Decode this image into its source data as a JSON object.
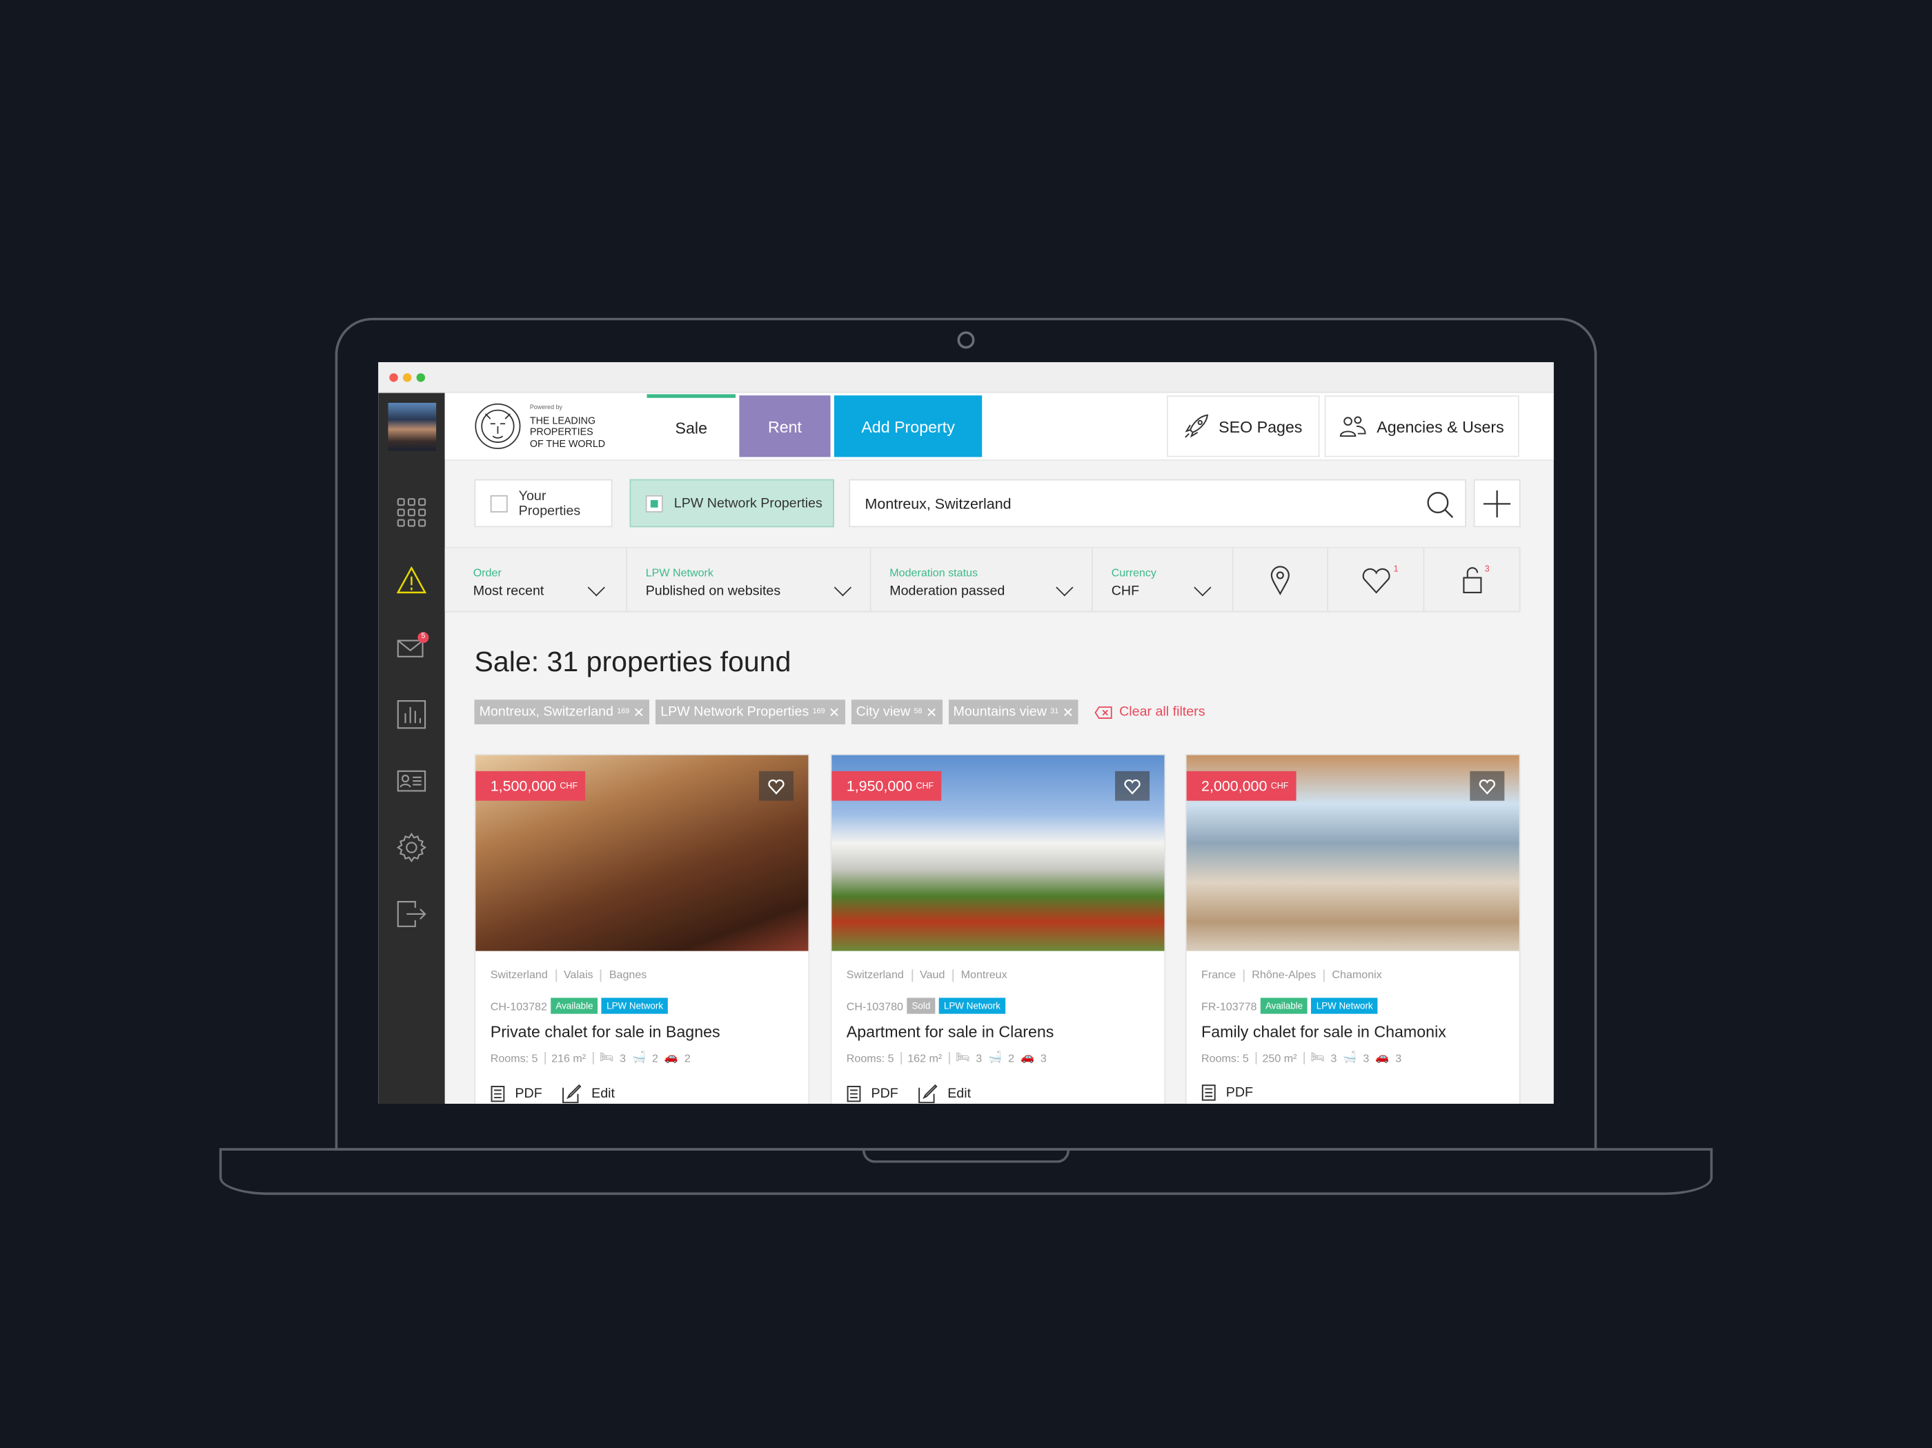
{
  "window": {
    "controls": [
      "close",
      "minimize",
      "maximize"
    ]
  },
  "sidebar": {
    "icons": [
      "grid-icon",
      "warning-icon",
      "mail-icon",
      "chart-icon",
      "contact-card-icon",
      "gear-icon",
      "logout-icon"
    ],
    "mail_badge": "5",
    "warning_color": "#e8d800"
  },
  "header": {
    "logo": {
      "powered": "Powered by",
      "line1": "THE LEADING",
      "line2": "PROPERTIES",
      "line3": "OF THE WORLD"
    },
    "tabs": [
      {
        "label": "Sale",
        "active": true
      },
      {
        "label": "Rent",
        "color": "#9082bd"
      },
      {
        "label": "Add Property",
        "color": "#0aa8df"
      }
    ],
    "seo": "SEO Pages",
    "agencies": "Agencies & Users"
  },
  "filters": {
    "your_properties": "Your Properties",
    "your_checked": false,
    "lpw_properties": "LPW Network Properties",
    "lpw_checked": true,
    "search_value": "Montreux, Switzerland"
  },
  "dropdowns": [
    {
      "label": "Order",
      "value": "Most recent"
    },
    {
      "label": "LPW Network",
      "value": "Published on websites"
    },
    {
      "label": "Moderation status",
      "value": "Moderation passed"
    },
    {
      "label": "Currency",
      "value": "CHF"
    }
  ],
  "quick": {
    "favorites_count": "1",
    "locked_count": "3"
  },
  "main": {
    "title": "Sale: 31 properties found",
    "chips": [
      {
        "label": "Montreux, Switzerland",
        "count": "169"
      },
      {
        "label": "LPW Network Properties",
        "count": "169"
      },
      {
        "label": "City view",
        "count": "58"
      },
      {
        "label": "Mountains view",
        "count": "31"
      }
    ],
    "clear": "Clear all filters"
  },
  "cards": [
    {
      "price": "1,500,000",
      "currency": "CHF",
      "loc": [
        "Switzerland",
        "Valais",
        "Bagnes"
      ],
      "ref": "CH-103782",
      "status": "Available",
      "status_color": "#3dbb84",
      "network": "LPW Network",
      "title": "Private chalet for sale in Bagnes",
      "rooms": "Rooms: 5",
      "area": "216 m²",
      "beds": "3",
      "baths": "2",
      "parking": "2",
      "pdf": "PDF",
      "edit": "Edit"
    },
    {
      "price": "1,950,000",
      "currency": "CHF",
      "loc": [
        "Switzerland",
        "Vaud",
        "Montreux"
      ],
      "ref": "CH-103780",
      "status": "Sold",
      "status_color": "#b5b5b5",
      "network": "LPW Network",
      "title": "Apartment for sale in Clarens",
      "rooms": "Rooms: 5",
      "area": "162 m²",
      "beds": "3",
      "baths": "2",
      "parking": "3",
      "pdf": "PDF",
      "edit": "Edit"
    },
    {
      "price": "2,000,000",
      "currency": "CHF",
      "loc": [
        "France",
        "Rhône-Alpes",
        "Chamonix"
      ],
      "ref": "FR-103778",
      "status": "Available",
      "status_color": "#3dbb84",
      "network": "LPW Network",
      "title": "Family chalet for sale in Chamonix",
      "rooms": "Rooms: 5",
      "area": "250 m²",
      "beds": "3",
      "baths": "3",
      "parking": "3",
      "pdf": "PDF"
    }
  ]
}
